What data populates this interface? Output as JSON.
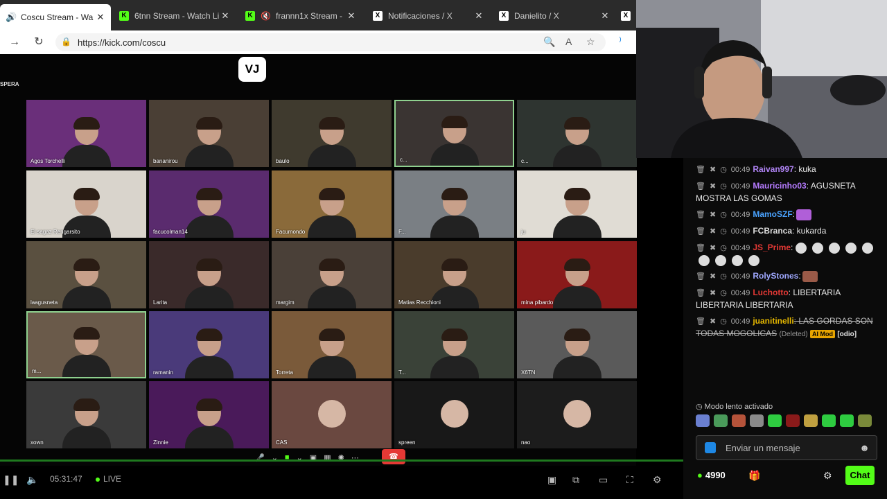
{
  "tabs": [
    {
      "title": "Coscu Stream - Wa",
      "icon": "speaker-icon",
      "active": true
    },
    {
      "title": "6tnn Stream - Watch Li",
      "icon": "kick-icon",
      "active": false
    },
    {
      "title": "frannn1x Stream - ",
      "icon": "kick-icon",
      "active": false
    },
    {
      "title": "Notificaciones / X",
      "icon": "x-icon",
      "active": false
    },
    {
      "title": "Danielito / X",
      "icon": "x-icon",
      "active": false
    }
  ],
  "address": {
    "url": "https://kick.com/coscu"
  },
  "video": {
    "logo": "VJ",
    "corner_text": "SPERA",
    "tiles": [
      {
        "name": "Agos Torchelli",
        "bg": "#6a2f7a"
      },
      {
        "name": "bananirou",
        "bg": "#4a3f35"
      },
      {
        "name": "baulo",
        "bg": "#3f3a2e"
      },
      {
        "name": "c...",
        "bg": "#3a3432"
      },
      {
        "name": "c...",
        "bg": "#2e3430"
      },
      {
        "name": "El sagaz Rengarsito",
        "bg": "#d9d4cc"
      },
      {
        "name": "facucolman14",
        "bg": "#5a2b6e"
      },
      {
        "name": "Facumondo",
        "bg": "#8a6a3a"
      },
      {
        "name": "F...",
        "bg": "#7a7f84"
      },
      {
        "name": "ju",
        "bg": "#e0dcd4"
      },
      {
        "name": "laagusneta",
        "bg": "#5a5040"
      },
      {
        "name": "Larita",
        "bg": "#3a2a2a"
      },
      {
        "name": "margim",
        "bg": "#4a4038"
      },
      {
        "name": "Matias Recchioni",
        "bg": "#4a3c2c"
      },
      {
        "name": "mina pibardo",
        "bg": "#8a1a1a"
      },
      {
        "name": "m...",
        "bg": "#6a5a4a"
      },
      {
        "name": "ramanin",
        "bg": "#4a3a7a"
      },
      {
        "name": "Torreta",
        "bg": "#7a5a3a"
      },
      {
        "name": "T...",
        "bg": "#3a4238"
      },
      {
        "name": "X6TN",
        "bg": "#5a5a5a"
      },
      {
        "name": "xown",
        "bg": "#3a3a3a"
      },
      {
        "name": "Zinnie",
        "bg": "#4a1a5a"
      },
      {
        "name": "CAS",
        "bg": "#6a4840"
      },
      {
        "name": "spreen",
        "bg": "#181818"
      },
      {
        "name": "nao",
        "bg": "#1c1c1c"
      }
    ]
  },
  "player": {
    "time": "05:31:47",
    "live_label": "LIVE"
  },
  "chat": {
    "messages": [
      {
        "time": "00:49",
        "user": "Raivan997",
        "user_color": "#b084f5",
        "text": ": kuka"
      },
      {
        "time": "00:49",
        "user": "Mauricinho03",
        "user_color": "#b57bff",
        "text": ": AGUSNETA MOSTRA LAS GOMAS"
      },
      {
        "time": "00:49",
        "user": "MamoSZF",
        "user_color": "#4aa3ff",
        "text": ":"
      },
      {
        "time": "00:49",
        "user": "FCBranca",
        "user_color": "#dddddd",
        "text": ": kukarda"
      },
      {
        "time": "00:49",
        "user": "JS_Prime",
        "user_color": "#e53935",
        "text": ":"
      },
      {
        "time": "00:49",
        "user": "RolyStones",
        "user_color": "#9fa8ff",
        "text": ":"
      },
      {
        "time": "00:49",
        "user": "Luchotto",
        "user_color": "#e53935",
        "text": ": LIBERTARIA LIBERTARIA LIBERTARIA"
      },
      {
        "time": "00:49",
        "user": "juanitinelli",
        "user_color": "#e6b800",
        "text": ": LAS GORDAS SON TODAS MOGOLICAS",
        "deleted": "(Deleted)",
        "aimod": "AI Mod",
        "tag": "[odio]"
      }
    ],
    "slow_mode": "Modo lento activado",
    "input_placeholder": "Enviar un mensaje",
    "points": "4990",
    "chat_button": "Chat"
  }
}
